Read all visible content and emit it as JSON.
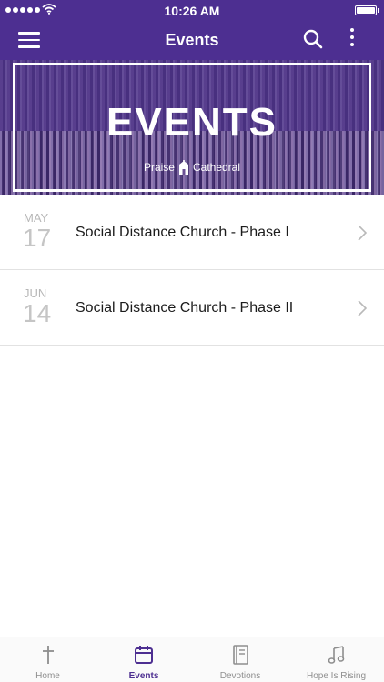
{
  "status_bar": {
    "time": "10:26 AM"
  },
  "nav": {
    "title": "Events"
  },
  "hero": {
    "heading": "EVENTS",
    "brand_left": "Praise",
    "brand_right": "Cathedral"
  },
  "events": [
    {
      "month": "MAY",
      "day": "17",
      "title": "Social Distance Church - Phase I"
    },
    {
      "month": "JUN",
      "day": "14",
      "title": "Social Distance Church - Phase II"
    }
  ],
  "tabs": [
    {
      "label": "Home",
      "icon": "cross-icon",
      "active": false
    },
    {
      "label": "Events",
      "icon": "calendar-icon",
      "active": true
    },
    {
      "label": "Devotions",
      "icon": "book-icon",
      "active": false
    },
    {
      "label": "Hope Is Rising",
      "icon": "music-note-icon",
      "active": false
    }
  ],
  "colors": {
    "brand": "#4d2f91",
    "tab_inactive": "#8e8e8e"
  }
}
